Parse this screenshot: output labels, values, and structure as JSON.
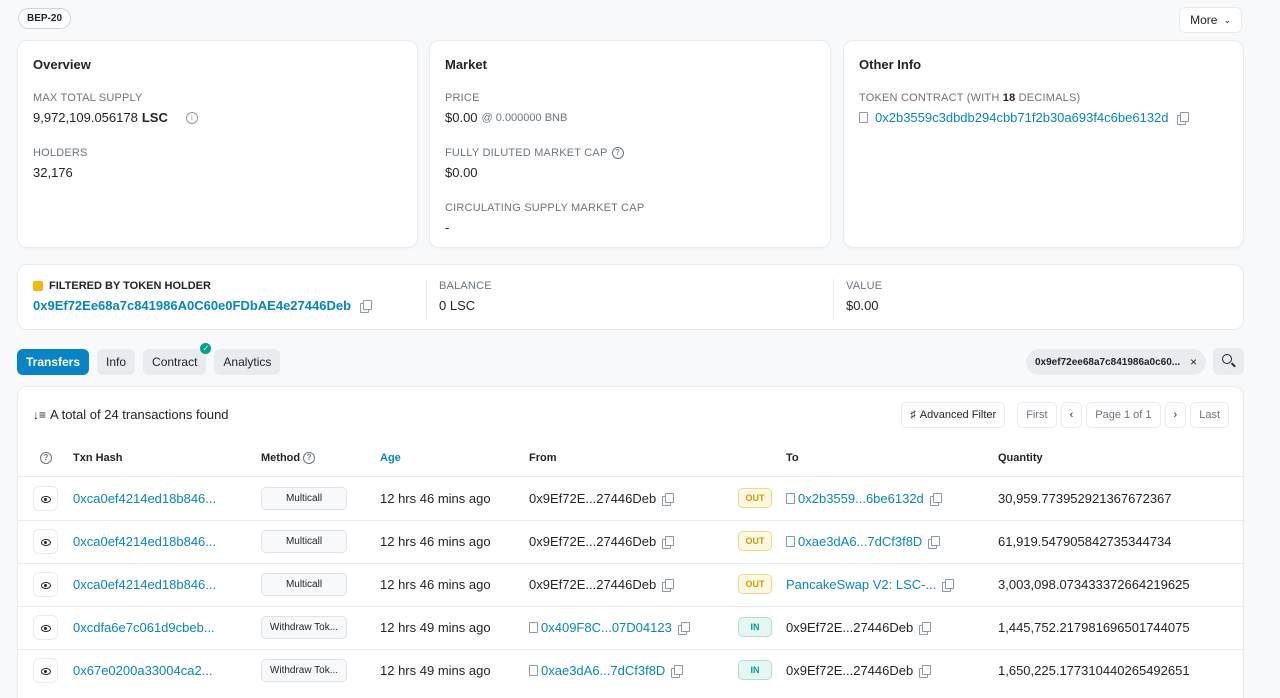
{
  "top": {
    "badge": "BEP-20",
    "more_label": "More"
  },
  "overview": {
    "title": "Overview",
    "max_supply_label": "MAX TOTAL SUPPLY",
    "max_supply_value": "9,972,109.056178",
    "symbol": "LSC",
    "holders_label": "HOLDERS",
    "holders_value": "32,176"
  },
  "market": {
    "title": "Market",
    "price_label": "PRICE",
    "price_value": "$0.00",
    "price_bnb": "@ 0.000000 BNB",
    "fdmc_label": "FULLY DILUTED MARKET CAP",
    "fdmc_value": "$0.00",
    "csmc_label": "CIRCULATING SUPPLY MARKET CAP",
    "csmc_value": "-"
  },
  "other": {
    "title": "Other Info",
    "contract_label_pre": "TOKEN CONTRACT (WITH ",
    "decimals": "18",
    "contract_label_post": " DECIMALS)",
    "contract_address": "0x2b3559c3dbdb294cbb71f2b30a693f4c6be6132d"
  },
  "filter": {
    "title": "FILTERED BY TOKEN HOLDER",
    "address": "0x9Ef72Ee68a7c841986A0C60e0FDbAE4e27446Deb",
    "balance_label": "BALANCE",
    "balance_value": "0 LSC",
    "value_label": "VALUE",
    "value_value": "$0.00"
  },
  "tabs": [
    "Transfers",
    "Info",
    "Contract",
    "Analytics"
  ],
  "active_filter": {
    "address": "0x9ef72ee68a7c841986a0c60...",
    "close": "×"
  },
  "table": {
    "summary": "A total of 24 transactions found",
    "advanced_filter": "Advanced Filter",
    "pager": {
      "first": "First",
      "prev": "‹",
      "page": "Page 1 of 1",
      "next": "›",
      "last": "Last"
    },
    "headers": {
      "txn": "Txn Hash",
      "method": "Method",
      "age": "Age",
      "from": "From",
      "to": "To",
      "quantity": "Quantity"
    },
    "rows": [
      {
        "hash": "0xca0ef4214ed18b846...",
        "method": "Multicall",
        "age": "12 hrs 46 mins ago",
        "from": "0x9Ef72E...27446Deb",
        "from_contract": false,
        "dir": "OUT",
        "to": "0x2b3559...6be6132d",
        "to_contract": true,
        "to_link": true,
        "qty": "30,959.773952921367672367"
      },
      {
        "hash": "0xca0ef4214ed18b846...",
        "method": "Multicall",
        "age": "12 hrs 46 mins ago",
        "from": "0x9Ef72E...27446Deb",
        "from_contract": false,
        "dir": "OUT",
        "to": "0xae3dA6...7dCf3f8D",
        "to_contract": true,
        "to_link": true,
        "qty": "61,919.547905842735344734"
      },
      {
        "hash": "0xca0ef4214ed18b846...",
        "method": "Multicall",
        "age": "12 hrs 46 mins ago",
        "from": "0x9Ef72E...27446Deb",
        "from_contract": false,
        "dir": "OUT",
        "to": "PancakeSwap V2: LSC-...",
        "to_contract": false,
        "to_link": true,
        "qty": "3,003,098.073433372664219625"
      },
      {
        "hash": "0xcdfa6e7c061d9cbeb...",
        "method": "Withdraw Tok...",
        "age": "12 hrs 49 mins ago",
        "from": "0x409F8C...07D04123",
        "from_contract": true,
        "dir": "IN",
        "to": "0x9Ef72E...27446Deb",
        "to_contract": false,
        "to_link": false,
        "qty": "1,445,752.217981696501744075"
      },
      {
        "hash": "0x67e0200a33004ca2...",
        "method": "Withdraw Tok...",
        "age": "12 hrs 49 mins ago",
        "from": "0xae3dA6...7dCf3f8D",
        "from_contract": true,
        "dir": "IN",
        "to": "0x9Ef72E...27446Deb",
        "to_contract": false,
        "to_link": false,
        "qty": "1,650,225.177310440265492651"
      }
    ]
  }
}
